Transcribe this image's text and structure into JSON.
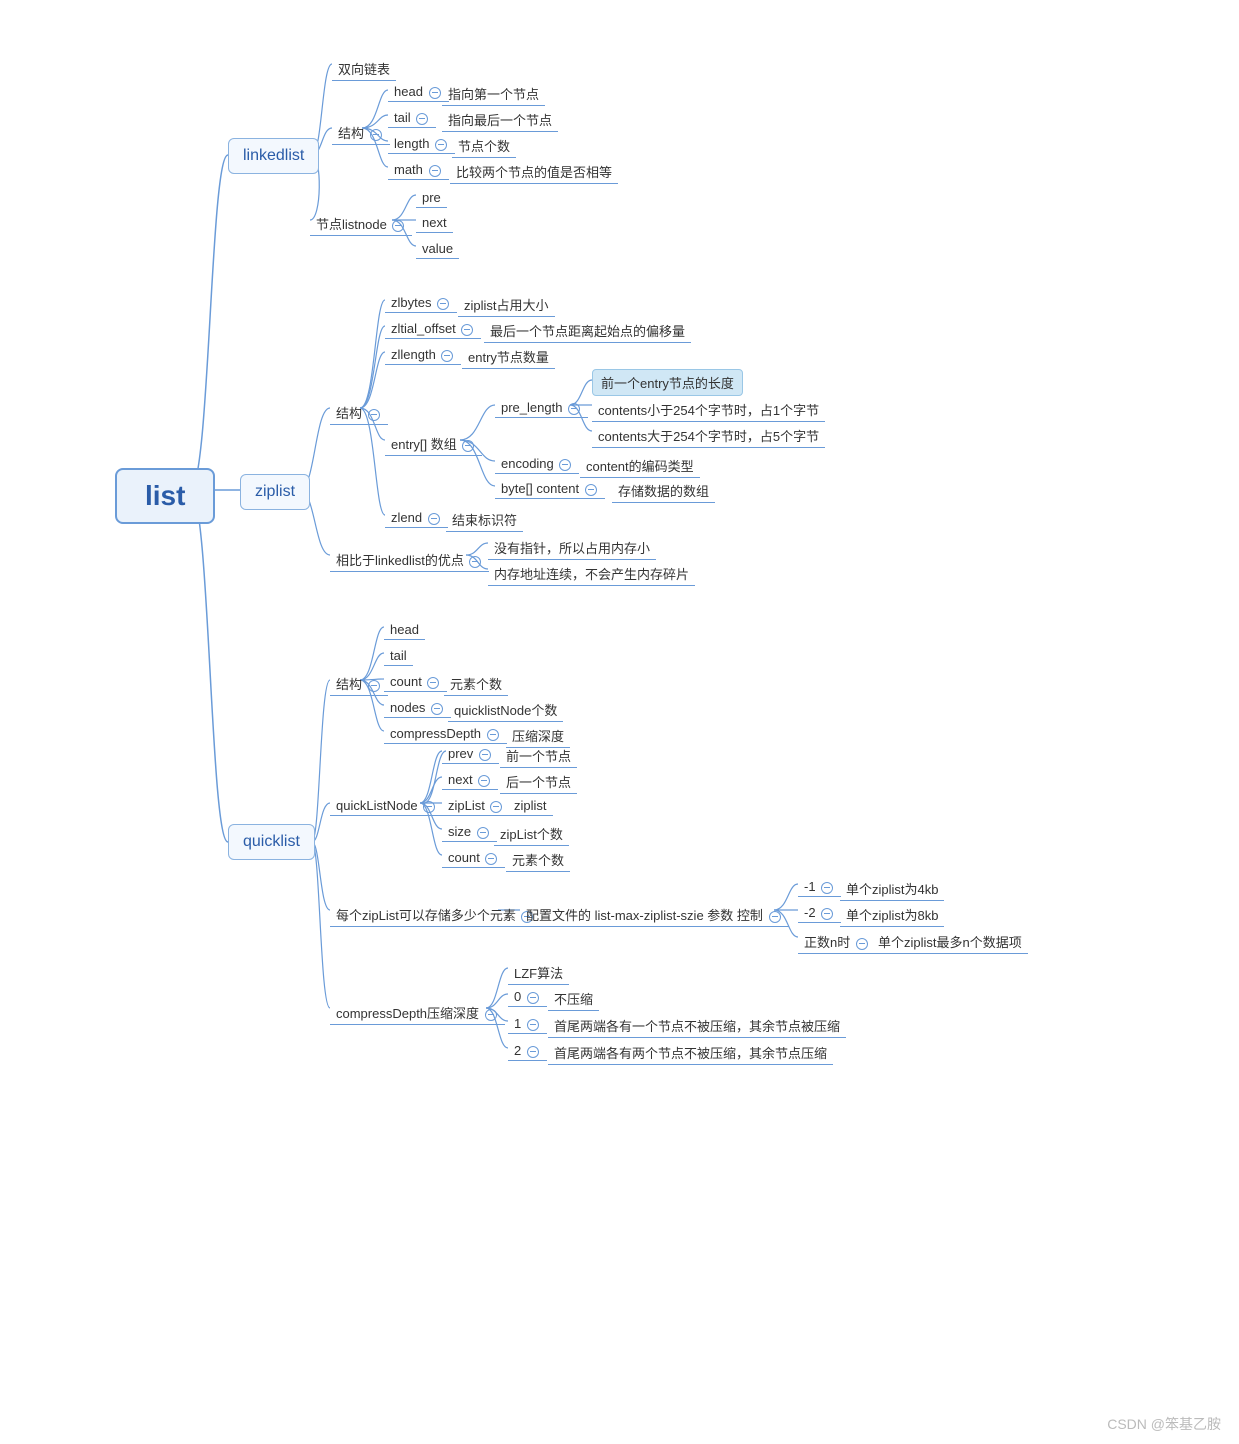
{
  "watermark": "CSDN @笨基乙胺",
  "root": "list",
  "linkedlist": {
    "label": "linkedlist",
    "n1": "双向链表",
    "struct": "结构",
    "head": "head",
    "head_d": "指向第一个节点",
    "tail": "tail",
    "tail_d": "指向最后一个节点",
    "length": "length",
    "length_d": "节点个数",
    "math": "math",
    "math_d": "比较两个节点的值是否相等",
    "listnode": "节点listnode",
    "pre": "pre",
    "next": "next",
    "value": "value"
  },
  "ziplist": {
    "label": "ziplist",
    "struct": "结构",
    "zlbytes": "zlbytes",
    "zlbytes_d": "ziplist占用大小",
    "zltial": "zltial_offset",
    "zltial_d": "最后一个节点距离起始点的偏移量",
    "zllength": "zllength",
    "zllength_d": "entry节点数量",
    "entry": "entry[] 数组",
    "pre_len": "pre_length",
    "pre_len_hl": "前一个entry节点的长度",
    "pre_len_d1": "contents小于254个字节时，占1个字节",
    "pre_len_d2": "contents大于254个字节时，占5个字节",
    "encoding": "encoding",
    "encoding_d": "content的编码类型",
    "byte_content": "byte[] content",
    "byte_content_d": "存储数据的数组",
    "zlend": "zlend",
    "zlend_d": "结束标识符",
    "adv": "相比于linkedlist的优点",
    "adv1": "没有指针，所以占用内存小",
    "adv2": "内存地址连续，不会产生内存碎片"
  },
  "quicklist": {
    "label": "quicklist",
    "struct": "结构",
    "head": "head",
    "tail": "tail",
    "count": "count",
    "count_d": "元素个数",
    "nodes": "nodes",
    "nodes_d": "quicklistNode个数",
    "cd": "compressDepth",
    "cd_d": "压缩深度",
    "qln": "quickListNode",
    "prev": "prev",
    "prev_d": "前一个节点",
    "next": "next",
    "next_d": "后一个节点",
    "zipList": "zipList",
    "zipList_d": "ziplist",
    "size": "size",
    "size_d": "zipList个数",
    "count2": "count",
    "count2_d": "元素个数",
    "store": "每个zipList可以存储多少个元素",
    "store_d": "配置文件的 list-max-ziplist-szie 参数 控制",
    "m1": "-1",
    "m1_d": "单个ziplist为4kb",
    "m2": "-2",
    "m2_d": "单个ziplist为8kb",
    "m3": "正数n时",
    "m3_d": "单个ziplist最多n个数据项",
    "cdepth": "compressDepth压缩深度",
    "lzf": "LZF算法",
    "c0": "0",
    "c0_d": "不压缩",
    "c1": "1",
    "c1_d": "首尾两端各有一个节点不被压缩，其余节点被压缩",
    "c2": "2",
    "c2_d": "首尾两端各有两个节点不被压缩，其余节点压缩"
  }
}
